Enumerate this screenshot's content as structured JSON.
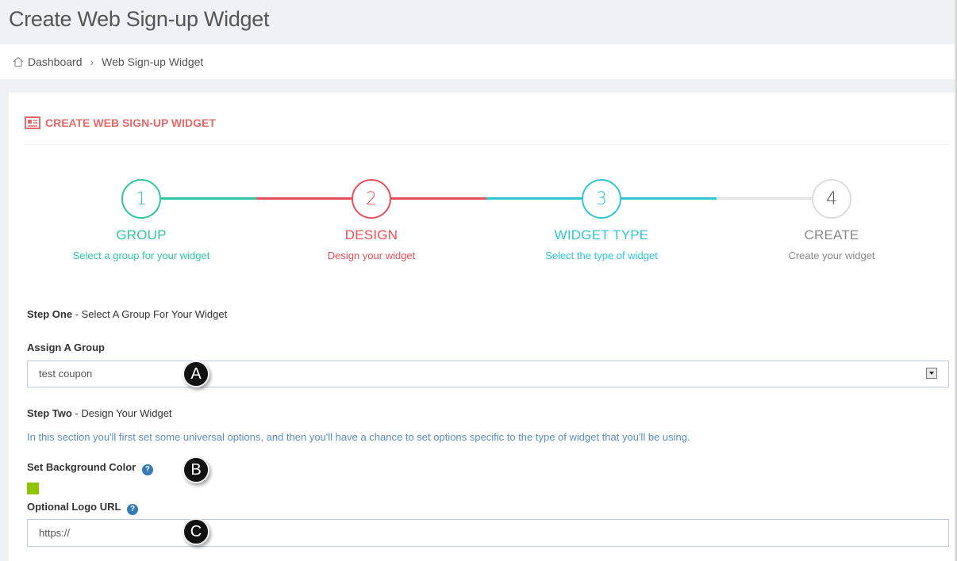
{
  "header": {
    "title": "Create Web Sign-up Widget"
  },
  "breadcrumb": {
    "home": "Dashboard",
    "separator": "›",
    "current": "Web Sign-up Widget"
  },
  "portlet": {
    "title": "CREATE WEB SIGN-UP WIDGET"
  },
  "wizard": {
    "steps": [
      {
        "number": "1",
        "title": "GROUP",
        "desc": "Select a group for your widget",
        "color": "#32c5a2"
      },
      {
        "number": "2",
        "title": "DESIGN",
        "desc": "Design your widget",
        "color": "#e7505a"
      },
      {
        "number": "3",
        "title": "WIDGET TYPE",
        "desc": "Select the type of widget",
        "color": "#32c5d2"
      },
      {
        "number": "4",
        "title": "CREATE",
        "desc": "Create your widget",
        "color": "#888888"
      }
    ]
  },
  "form": {
    "step_one_label": "Step One",
    "step_one_text": " - Select A Group For Your Widget",
    "assign_group_label": "Assign A Group",
    "group_selected": "test coupon",
    "step_two_label": "Step Two",
    "step_two_text": " - Design Your Widget",
    "info_text": "In this section you'll first set some universal options, and then you'll have a chance to set options specific to the type of widget that you'll be using.",
    "bg_color_label": "Set Background Color",
    "bg_color_value": "#8fc400",
    "logo_url_label": "Optional Logo URL",
    "logo_url_value": "https://"
  },
  "markers": {
    "a": "A",
    "b": "B",
    "c": "C"
  }
}
